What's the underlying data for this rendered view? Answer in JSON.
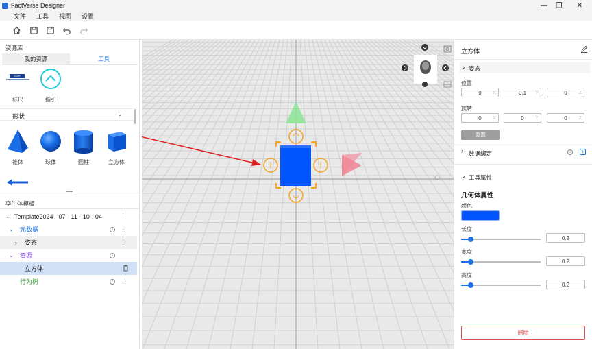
{
  "window": {
    "title": "FactVerse Designer"
  },
  "menu": [
    "文件",
    "工具",
    "视图",
    "设置"
  ],
  "left_panel": {
    "library_title": "资源库",
    "tabs": [
      {
        "label": "我的资源",
        "active": false
      },
      {
        "label": "工具",
        "active": true
      }
    ],
    "tools": [
      {
        "label": "标尺",
        "ruler_text": "0.1m"
      },
      {
        "label": "指引"
      }
    ],
    "shapes_header": "形状",
    "shapes": [
      {
        "label": "锥体"
      },
      {
        "label": "球体"
      },
      {
        "label": "圆柱"
      },
      {
        "label": "立方体"
      }
    ],
    "template_title": "孪生体模板",
    "tree": [
      {
        "label": "Template2024 - 07 - 11 - 10 - 04",
        "color": "#222222",
        "expanded": true
      },
      {
        "label": "元数据",
        "color": "#1a73e8",
        "expanded": true
      },
      {
        "label": "姿态",
        "color": "#222222",
        "expanded": false
      },
      {
        "label": "资源",
        "color": "#7b3fe4",
        "expanded": true
      },
      {
        "label": "立方体",
        "color": "#222222",
        "selected": true
      },
      {
        "label": "行为树",
        "color": "#2ca02c"
      }
    ]
  },
  "right_panel": {
    "object_name": "立方体",
    "pose_section": "姿态",
    "position_label": "位置",
    "position": [
      {
        "value": "0",
        "axis": "X"
      },
      {
        "value": "0.1",
        "axis": "Y"
      },
      {
        "value": "0",
        "axis": "Z"
      }
    ],
    "rotation_label": "旋转",
    "rotation": [
      {
        "value": "0",
        "axis": "X"
      },
      {
        "value": "0",
        "axis": "Y"
      },
      {
        "value": "0",
        "axis": "Z"
      }
    ],
    "reset_label": "重置",
    "data_binding_section": "数据绑定",
    "tool_props_section": "工具属性",
    "geometry_title": "几何体属性",
    "color_label": "颜色",
    "color_value": "#0055ff",
    "length_label": "长度",
    "length": {
      "value": "0.2",
      "fraction": 0.12
    },
    "width_label": "宽度",
    "width": {
      "value": "0.2",
      "fraction": 0.12
    },
    "height_label": "高度",
    "height": {
      "value": "0.2",
      "fraction": 0.12
    },
    "delete_label": "删除"
  },
  "colors": {
    "accent": "#1a73e8",
    "cube": "#0055ff",
    "gizmo": "#f5a623",
    "arrow": "#e02020",
    "delete": "#e05050"
  }
}
